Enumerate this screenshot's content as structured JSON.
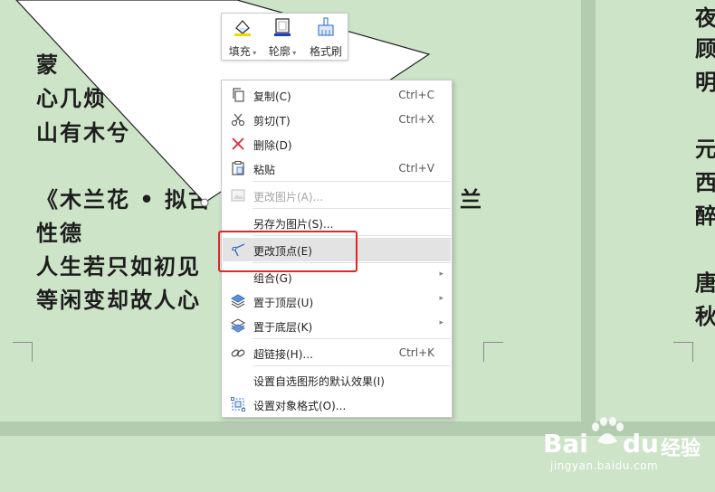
{
  "document": {
    "left_lines": [
      "蒙",
      "心几烦",
      "山有木兮",
      "《木兰花 • 拟古",
      "性德",
      "人生若只如初见",
      "等闲变却故人心"
    ],
    "left_line_fragments": {
      "top_tail": "。",
      "line4_tail": "兰"
    },
    "right_lines": [
      "夜",
      "顾",
      "明",
      "元",
      "西",
      "醉",
      "唐",
      "秋"
    ]
  },
  "mini_toolbar": {
    "buttons": [
      {
        "label": "填充",
        "has_dropdown": true,
        "icon": "fill-bucket-icon",
        "accent": "#f5d800"
      },
      {
        "label": "轮廓",
        "has_dropdown": true,
        "icon": "outline-icon",
        "accent": "#1a3bd6"
      },
      {
        "label": "格式刷",
        "has_dropdown": false,
        "icon": "format-painter-icon"
      }
    ]
  },
  "context_menu": {
    "items": [
      {
        "label": "复制(C)",
        "shortcut": "Ctrl+C",
        "icon": "copy-icon",
        "enabled": true
      },
      {
        "label": "剪切(T)",
        "shortcut": "Ctrl+X",
        "icon": "scissors-icon",
        "enabled": true
      },
      {
        "label": "删除(D)",
        "shortcut": "",
        "icon": "delete-x-icon",
        "enabled": true,
        "icon_color": "#e0252b"
      },
      {
        "label": "粘贴",
        "shortcut": "Ctrl+V",
        "icon": "paste-icon",
        "enabled": true
      },
      {
        "label": "更改图片(A)...",
        "shortcut": "",
        "icon": "change-picture-icon",
        "enabled": false
      },
      {
        "label": "另存为图片(S)...",
        "shortcut": "",
        "icon": "",
        "enabled": true
      },
      {
        "label": "更改顶点(E)",
        "shortcut": "",
        "icon": "edit-points-icon",
        "enabled": true,
        "highlighted": true
      },
      {
        "label": "组合(G)",
        "shortcut": "",
        "icon": "",
        "enabled": true,
        "submenu": true
      },
      {
        "label": "置于顶层(U)",
        "shortcut": "",
        "icon": "bring-to-front-icon",
        "enabled": true,
        "submenu": true
      },
      {
        "label": "置于底层(K)",
        "shortcut": "",
        "icon": "send-to-back-icon",
        "enabled": true,
        "submenu": true
      },
      {
        "label": "超链接(H)...",
        "shortcut": "Ctrl+K",
        "icon": "hyperlink-icon",
        "enabled": true
      },
      {
        "label": "设置自选图形的默认效果(I)",
        "shortcut": "",
        "icon": "",
        "enabled": true
      },
      {
        "label": "设置对象格式(O)...",
        "shortcut": "",
        "icon": "format-object-icon",
        "enabled": true
      }
    ],
    "submenu_arrow": "▸"
  },
  "watermark": {
    "brand": "Bai",
    "brand2": "du",
    "suffix": "经验",
    "url": "jingyan.baidu.com"
  },
  "colors": {
    "page_bg": "#cde4c8",
    "gutter": "#b3ccb0",
    "highlight_border": "#e0252b"
  }
}
